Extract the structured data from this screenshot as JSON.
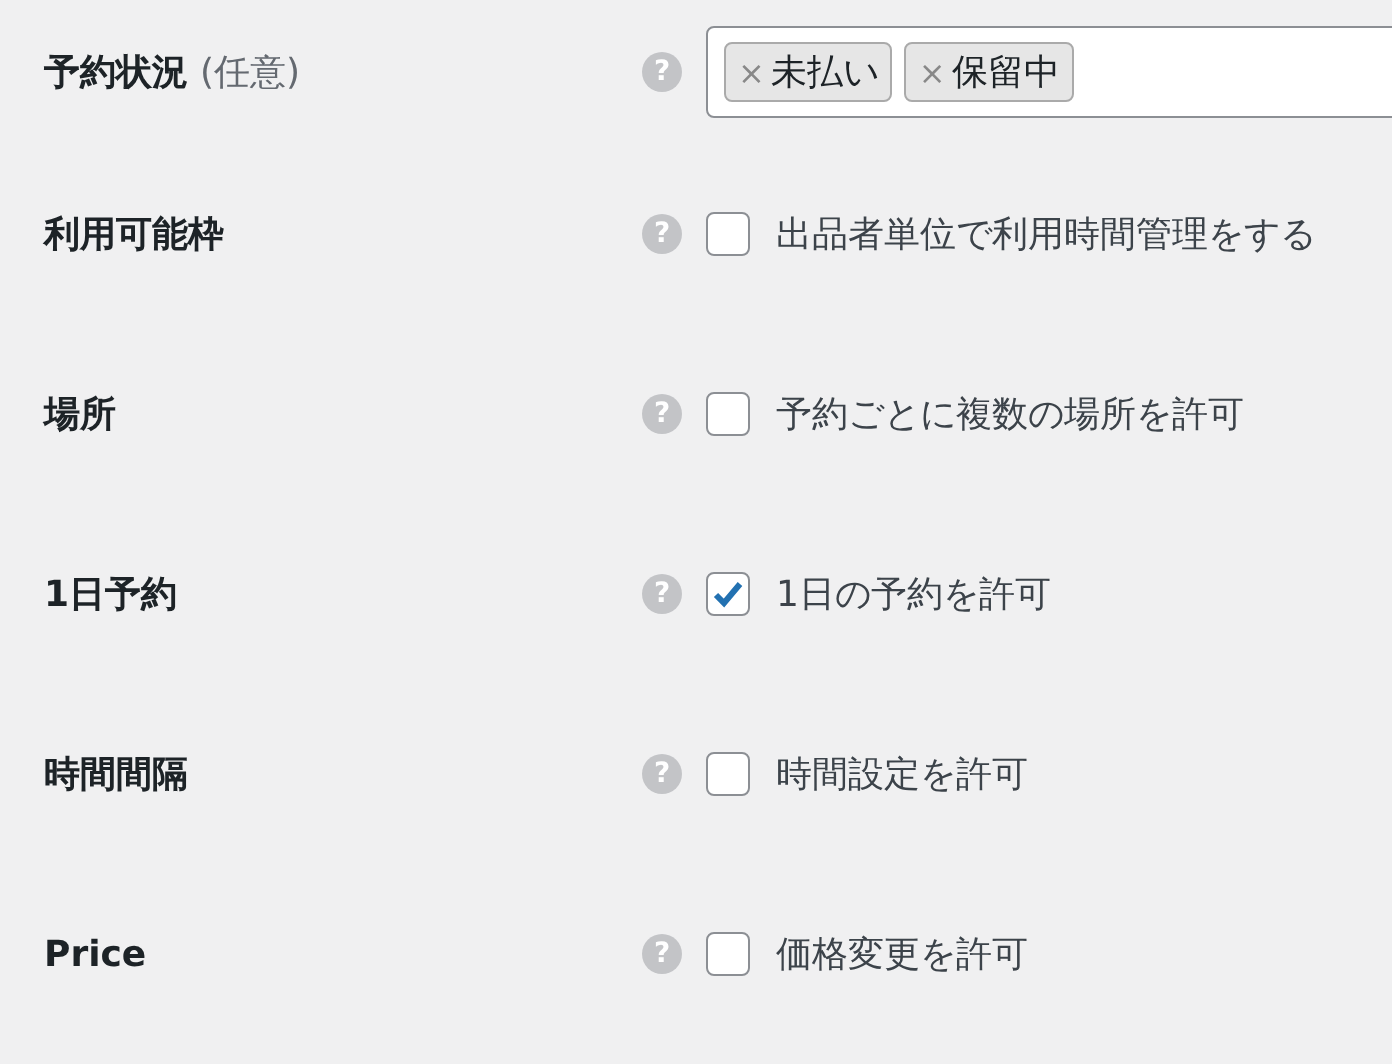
{
  "fields": [
    {
      "kind": "tags",
      "label": "予約状況",
      "optional": "(任意)",
      "help": "?",
      "tags": [
        {
          "text": "未払い",
          "remove": "×"
        },
        {
          "text": "保留中",
          "remove": "×"
        }
      ]
    },
    {
      "kind": "checkbox",
      "label": "利用可能枠",
      "help": "?",
      "text": "出品者単位で利用時間管理をする",
      "checked": false
    },
    {
      "kind": "checkbox",
      "label": "場所",
      "help": "?",
      "text": "予約ごとに複数の場所を許可",
      "checked": false
    },
    {
      "kind": "checkbox",
      "label": "1日予約",
      "help": "?",
      "text": "1日の予約を許可",
      "checked": true
    },
    {
      "kind": "checkbox",
      "label": "時間間隔",
      "help": "?",
      "text": "時間設定を許可",
      "checked": false
    },
    {
      "kind": "checkbox",
      "label": "Price",
      "help": "?",
      "text": "価格変更を許可",
      "checked": false
    }
  ]
}
